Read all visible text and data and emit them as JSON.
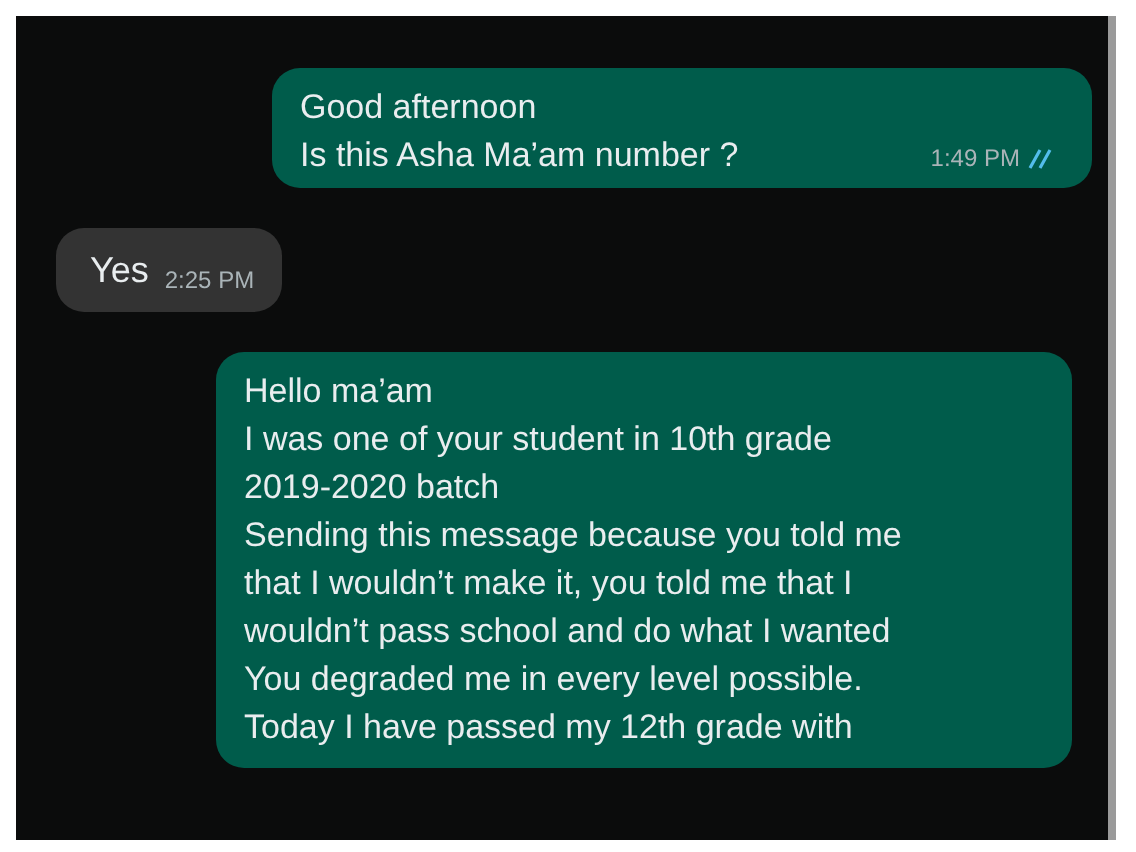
{
  "messages": [
    {
      "kind": "outgoing",
      "lines": [
        "Good afternoon",
        "Is this Asha Ma’am number ?"
      ],
      "time": "1:49 PM",
      "read": true
    },
    {
      "kind": "incoming",
      "lines": [
        "Yes"
      ],
      "time": "2:25 PM"
    },
    {
      "kind": "outgoing",
      "lines": [
        "Hello ma’am",
        "I was one of your student in 10th grade",
        "2019-2020 batch",
        "Sending this message because you told me",
        "that I wouldn’t make it, you told me that I",
        "wouldn’t pass school and do what I wanted",
        "You degraded me in every level possible.",
        "Today I have passed my 12th grade with"
      ]
    }
  ]
}
